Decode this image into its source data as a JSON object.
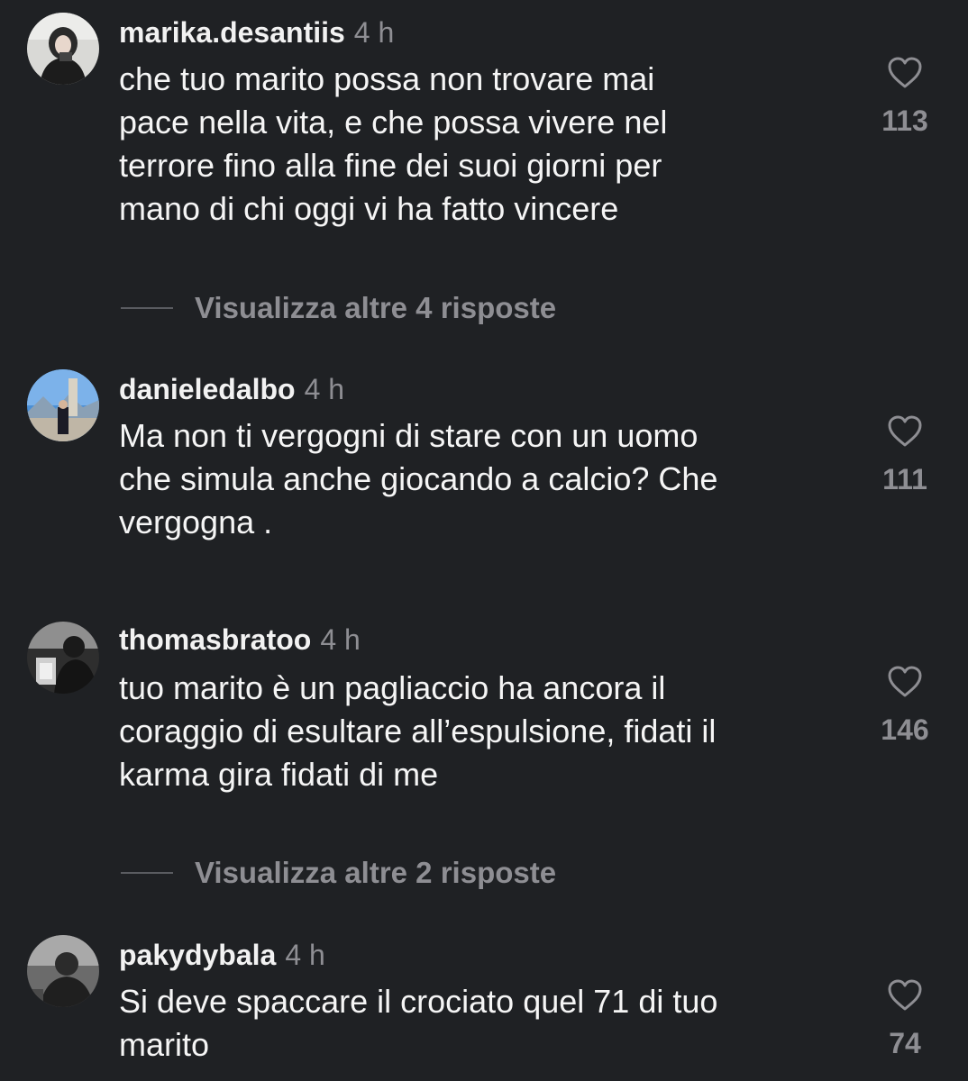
{
  "comments": [
    {
      "username": "marika.desantiis",
      "time": "4 h",
      "text": "che tuo marito possa non trovare mai\npace nella vita, e che possa vivere nel\nterrore fino alla fine dei suoi giorni per\nmano di chi oggi vi ha fatto vincere",
      "likes": "113",
      "avatar_icon": "avatar-photo-icon",
      "more_replies": "Visualizza altre 4 risposte"
    },
    {
      "username": "danieledalbo",
      "time": "4 h",
      "text": "Ma non ti vergogni di stare con un uomo\nche simula anche giocando a calcio? Che\nvergogna .",
      "likes": "111",
      "avatar_icon": "avatar-photo-icon"
    },
    {
      "username": "thomasbratoo",
      "time": "4 h",
      "text": "tuo marito è un pagliaccio ha ancora il\ncoraggio di esultare all’espulsione, fidati il\nkarma gira fidati di me",
      "likes": "146",
      "avatar_icon": "avatar-photo-icon",
      "more_replies": "Visualizza altre 2 risposte"
    },
    {
      "username": "pakydybala",
      "time": "4 h",
      "text": "Si deve spaccare il crociato quel 71 di tuo\nmarito",
      "likes": "74",
      "avatar_icon": "avatar-photo-icon"
    }
  ],
  "like_icon": "heart-outline-icon",
  "colors": {
    "background": "#1f2124",
    "text": "#f5f5f5",
    "secondary": "#8e8e93"
  }
}
